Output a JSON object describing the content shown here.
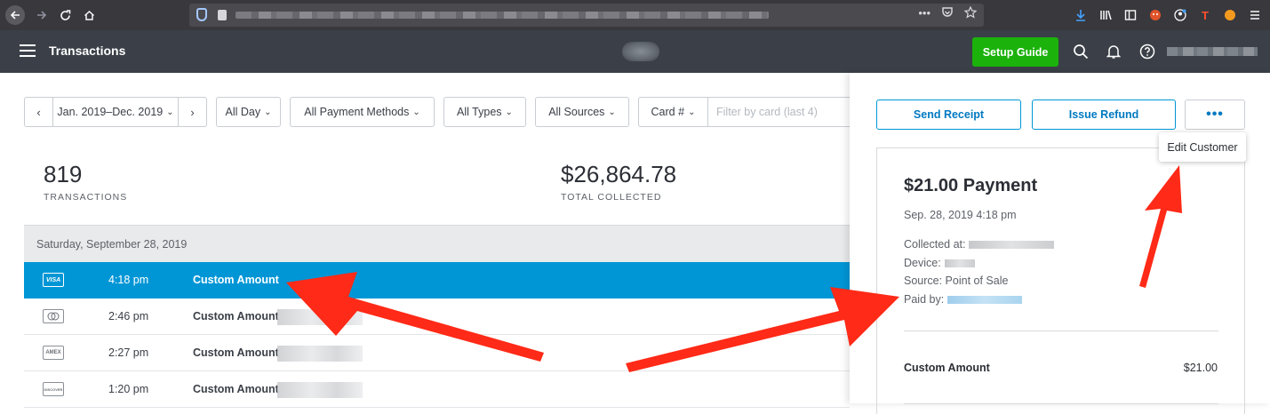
{
  "app": {
    "title": "Transactions"
  },
  "header": {
    "setup_guide_label": "Setup Guide"
  },
  "filters": {
    "date_range": "Jan. 2019–Dec. 2019",
    "day": "All Day",
    "payment_methods": "All Payment Methods",
    "types": "All Types",
    "sources": "All Sources",
    "card": "Card #",
    "card_placeholder": "Filter by card (last 4)"
  },
  "stats": [
    {
      "value": "819",
      "label": "TRANSACTIONS"
    },
    {
      "value": "$26,864.78",
      "label": "TOTAL COLLECTED"
    }
  ],
  "list": {
    "day_header": "Saturday, September 28, 2019",
    "rows": [
      {
        "card": "VISA",
        "time": "4:18 pm",
        "description": "Custom Amount",
        "selected": true
      },
      {
        "card": "MASTERCARD",
        "time": "2:46 pm",
        "description": "Custom Amount",
        "selected": false
      },
      {
        "card": "AMEX",
        "time": "2:27 pm",
        "description": "Custom Amount",
        "selected": false
      },
      {
        "card": "DISCOVER",
        "time": "1:20 pm",
        "description": "Custom Amount",
        "selected": false
      }
    ]
  },
  "panel": {
    "send_receipt_label": "Send Receipt",
    "issue_refund_label": "Issue Refund",
    "more_label": "•••",
    "tooltip": "Edit Customer",
    "payment_title": "$21.00 Payment",
    "payment_date": "Sep. 28, 2019 4:18 pm",
    "collected_at_label": "Collected at:",
    "device_label": "Device:",
    "source_line": "Source: Point of Sale",
    "paid_by_label": "Paid by:",
    "item_name": "Custom Amount",
    "item_amount": "$21.00"
  },
  "colors": {
    "header_bg": "#3b4048",
    "setup_green": "#1bb20b",
    "selected_row": "#0096d6",
    "link_blue": "#0079c1",
    "annotation_red": "#ff2a17"
  }
}
